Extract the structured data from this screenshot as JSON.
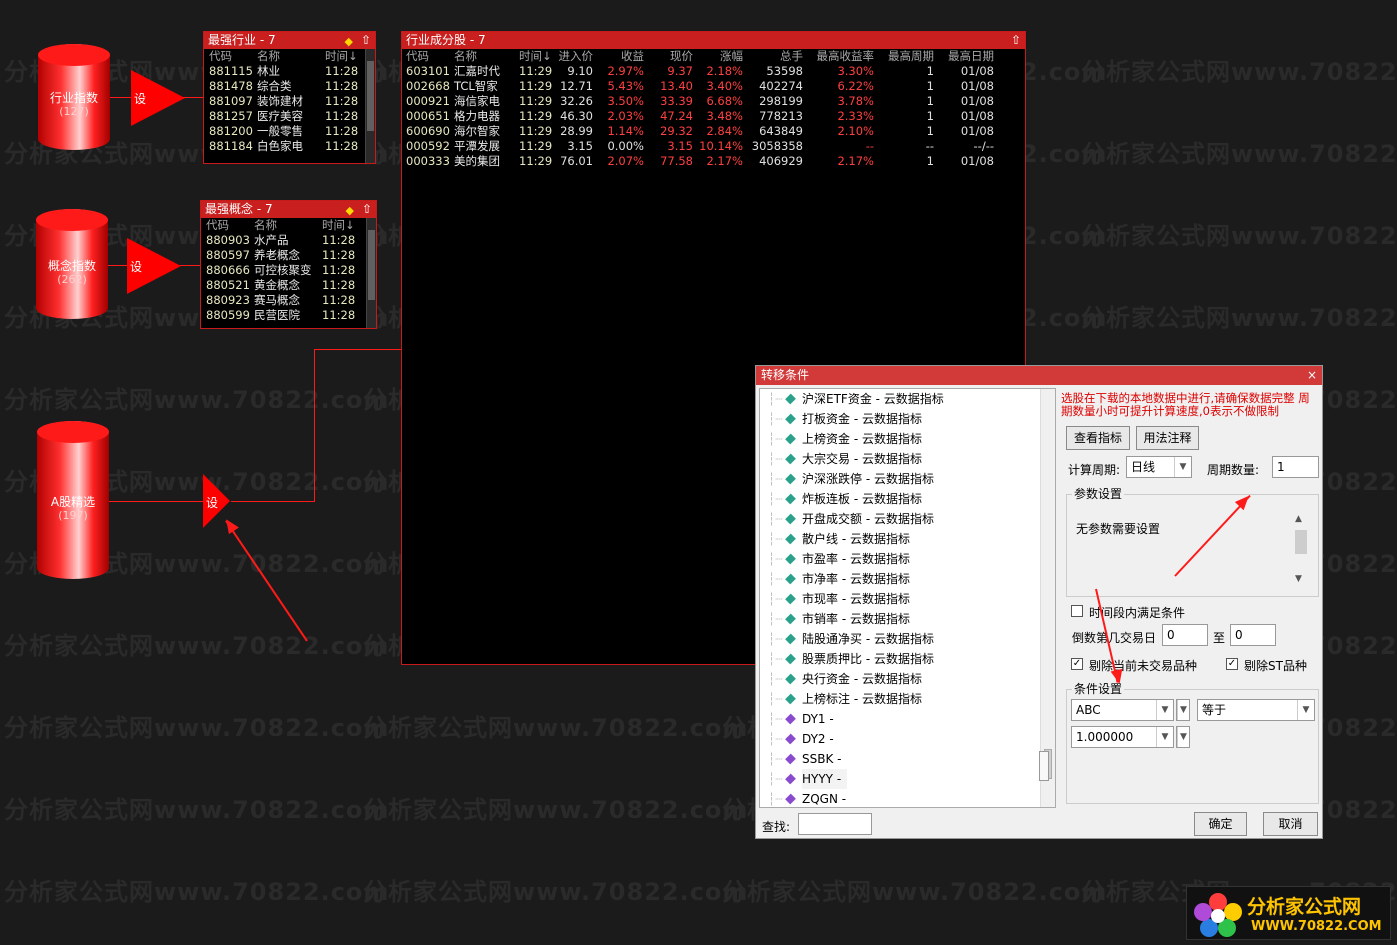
{
  "watermark": "分析家公式网www.70822.com",
  "sources": [
    {
      "label": "行业指数",
      "count": "(127)",
      "node": "设"
    },
    {
      "label": "概念指数",
      "count": "(262)",
      "node": "设"
    },
    {
      "label": "A股精选",
      "count": "(197)",
      "node": "设"
    }
  ],
  "industry": {
    "title": "最强行业 - 7",
    "headers": [
      "代码",
      "名称",
      "时间↓"
    ],
    "rows": [
      [
        "881115",
        "林业",
        "11:28"
      ],
      [
        "881478",
        "综合类",
        "11:28"
      ],
      [
        "881097",
        "装饰建材",
        "11:28"
      ],
      [
        "881257",
        "医疗美容",
        "11:28"
      ],
      [
        "881200",
        "一般零售",
        "11:28"
      ],
      [
        "881184",
        "白色家电",
        "11:28"
      ]
    ]
  },
  "concept": {
    "title": "最强概念 - 7",
    "headers": [
      "代码",
      "名称",
      "时间↓"
    ],
    "rows": [
      [
        "880903",
        "水产品",
        "11:28"
      ],
      [
        "880597",
        "养老概念",
        "11:28"
      ],
      [
        "880666",
        "可控核聚变",
        "11:28"
      ],
      [
        "880521",
        "黄金概念",
        "11:28"
      ],
      [
        "880923",
        "赛马概念",
        "11:28"
      ],
      [
        "880599",
        "民营医院",
        "11:28"
      ]
    ]
  },
  "stocks": {
    "title": "行业成分股 - 7",
    "headers": [
      "代码",
      "名称",
      "时间↓",
      "进入价",
      "收益",
      "现价",
      "涨幅",
      "总手",
      "最高收益率",
      "最高周期",
      "最高日期"
    ],
    "rows": [
      [
        "603101",
        "汇嘉时代",
        "11:29",
        "9.10",
        "2.97%",
        "9.37",
        "2.18%",
        "53598",
        "3.30%",
        "1",
        "01/08"
      ],
      [
        "002668",
        "TCL智家",
        "11:29",
        "12.71",
        "5.43%",
        "13.40",
        "3.40%",
        "402274",
        "6.22%",
        "1",
        "01/08"
      ],
      [
        "000921",
        "海信家电",
        "11:29",
        "32.26",
        "3.50%",
        "33.39",
        "6.68%",
        "298199",
        "3.78%",
        "1",
        "01/08"
      ],
      [
        "000651",
        "格力电器",
        "11:29",
        "46.30",
        "2.03%",
        "47.24",
        "3.48%",
        "778213",
        "2.33%",
        "1",
        "01/08"
      ],
      [
        "600690",
        "海尔智家",
        "11:29",
        "28.99",
        "1.14%",
        "29.32",
        "2.84%",
        "643849",
        "2.10%",
        "1",
        "01/08"
      ],
      [
        "000592",
        "平潭发展",
        "11:29",
        "3.15",
        "0.00%",
        "3.15",
        "10.14%",
        "3058358",
        "--",
        "--",
        "--/--"
      ],
      [
        "000333",
        "美的集团",
        "11:29",
        "76.01",
        "2.07%",
        "77.58",
        "2.17%",
        "406929",
        "2.17%",
        "1",
        "01/08"
      ]
    ]
  },
  "dialog": {
    "title": "转移条件",
    "close": "×",
    "tree": [
      {
        "label": "沪深ETF资金 - 云数据指标",
        "kind": "cloud"
      },
      {
        "label": "打板资金 - 云数据指标",
        "kind": "cloud"
      },
      {
        "label": "上榜资金 - 云数据指标",
        "kind": "cloud"
      },
      {
        "label": "大宗交易 - 云数据指标",
        "kind": "cloud"
      },
      {
        "label": "沪深涨跌停 - 云数据指标",
        "kind": "cloud"
      },
      {
        "label": "炸板连板 - 云数据指标",
        "kind": "cloud"
      },
      {
        "label": "开盘成交额 - 云数据指标",
        "kind": "cloud"
      },
      {
        "label": "散户线 - 云数据指标",
        "kind": "cloud"
      },
      {
        "label": "市盈率 - 云数据指标",
        "kind": "cloud"
      },
      {
        "label": "市净率 - 云数据指标",
        "kind": "cloud"
      },
      {
        "label": "市现率 - 云数据指标",
        "kind": "cloud"
      },
      {
        "label": "市销率 - 云数据指标",
        "kind": "cloud"
      },
      {
        "label": "陆股通净买 - 云数据指标",
        "kind": "cloud"
      },
      {
        "label": "股票质押比 - 云数据指标",
        "kind": "cloud"
      },
      {
        "label": "央行资金 - 云数据指标",
        "kind": "cloud"
      },
      {
        "label": "上榜标注 - 云数据指标",
        "kind": "cloud"
      },
      {
        "label": "DY1 -",
        "kind": "user"
      },
      {
        "label": "DY2 -",
        "kind": "user"
      },
      {
        "label": "SSBK -",
        "kind": "user"
      },
      {
        "label": "HYYY -",
        "kind": "user"
      },
      {
        "label": "ZQGN -",
        "kind": "user"
      }
    ],
    "warning": "选股在下载的本地数据中进行,请确保数据完整 周期数量小时可提升计算速度,0表示不做限制",
    "view_indicator": "查看指标",
    "usage_notes": "用法注释",
    "period_label": "计算周期:",
    "period_value": "日线",
    "count_label": "周期数量:",
    "count_value": "1",
    "params_group": "参数设置",
    "params_text": "无参数需要设置",
    "time_range_label": "时间段内满足条件",
    "countdown_label": "倒数第几交易日",
    "from_value": "0",
    "to_label": "至",
    "to_value": "0",
    "exclude_suspended": "剔除当前未交易品种",
    "exclude_st": "剔除ST品种",
    "cond_group": "条件设置",
    "cond_field": "ABC",
    "cond_op": "等于",
    "cond_value": "1.000000",
    "find_label": "查找:",
    "find_value": "",
    "ok": "确定",
    "cancel": "取消"
  },
  "logo": {
    "title": "分析家公式网",
    "url": "WWW.70822.COM"
  }
}
